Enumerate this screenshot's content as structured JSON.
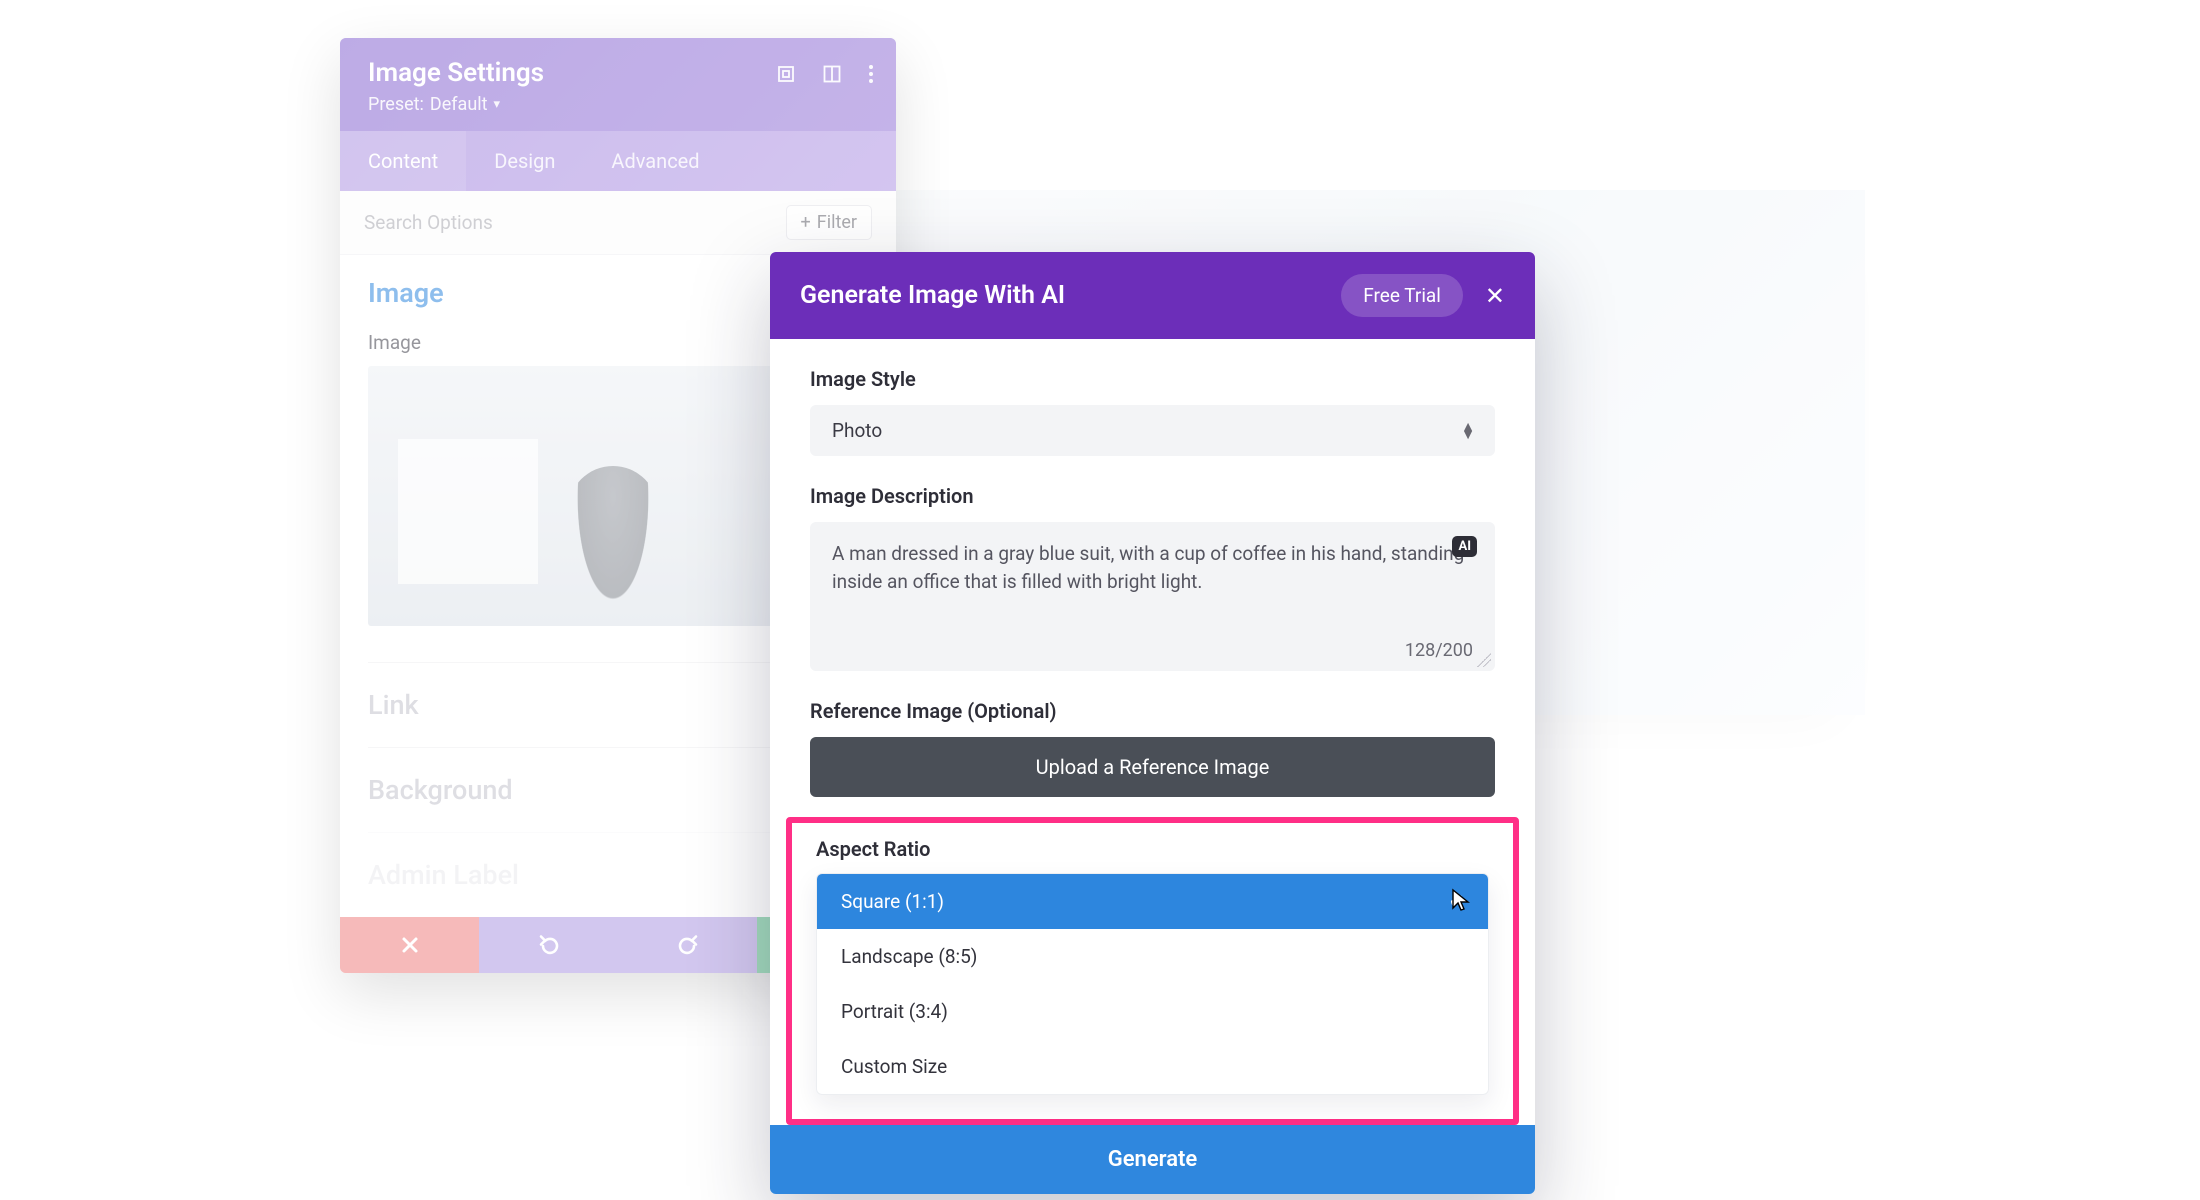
{
  "settings": {
    "title": "Image Settings",
    "preset_prefix": "Preset:",
    "preset_value": "Default",
    "tabs": {
      "content": "Content",
      "design": "Design",
      "advanced": "Advanced"
    },
    "search_placeholder": "Search Options",
    "filter_label": "Filter",
    "section_title": "Image",
    "image_label": "Image",
    "collapsed": {
      "link": "Link",
      "background": "Background",
      "admin": "Admin Label"
    }
  },
  "ai": {
    "title": "Generate Image With AI",
    "trial": "Free Trial",
    "style_label": "Image Style",
    "style_value": "Photo",
    "desc_label": "Image Description",
    "desc_text": "A man dressed in a gray blue suit, with a cup of coffee in his hand, standing inside an office that is filled with bright light.",
    "desc_counter": "128/200",
    "ai_badge": "AI",
    "ref_label": "Reference Image (Optional)",
    "upload_label": "Upload a Reference Image",
    "ratio_label": "Aspect Ratio",
    "ratio_options": {
      "square": "Square (1:1)",
      "landscape": "Landscape (8:5)",
      "portrait": "Portrait (3:4)",
      "custom": "Custom Size"
    },
    "generate": "Generate"
  }
}
